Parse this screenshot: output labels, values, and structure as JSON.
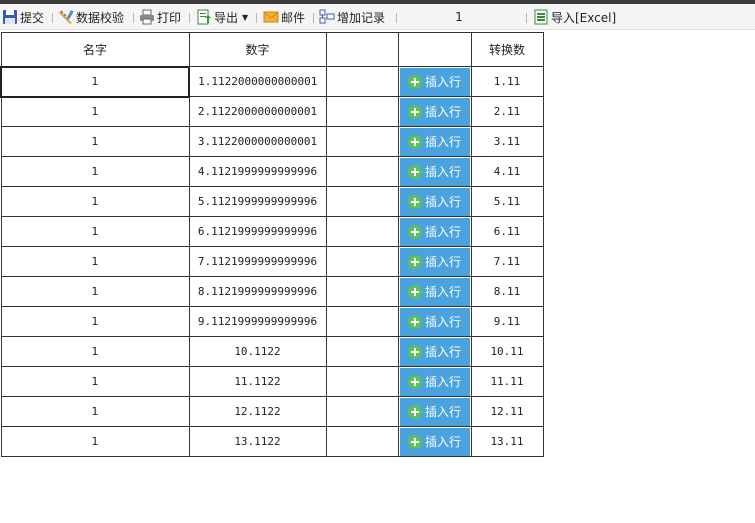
{
  "toolbar": {
    "submit_label": "提交",
    "validate_label": "数据校验",
    "print_label": "打印",
    "export_label": "导出",
    "mail_label": "邮件",
    "add_record_label": "增加记录",
    "page_value": "1",
    "import_label": "导入[Excel]"
  },
  "table": {
    "headers": [
      "名字",
      "数字",
      "",
      "",
      "转换数"
    ],
    "insert_label": "插入行",
    "rows": [
      {
        "name": "1",
        "number": "1.1122000000000001",
        "converted": "1.11"
      },
      {
        "name": "1",
        "number": "2.1122000000000001",
        "converted": "2.11"
      },
      {
        "name": "1",
        "number": "3.1122000000000001",
        "converted": "3.11"
      },
      {
        "name": "1",
        "number": "4.1121999999999996",
        "converted": "4.11"
      },
      {
        "name": "1",
        "number": "5.1121999999999996",
        "converted": "5.11"
      },
      {
        "name": "1",
        "number": "6.1121999999999996",
        "converted": "6.11"
      },
      {
        "name": "1",
        "number": "7.1121999999999996",
        "converted": "7.11"
      },
      {
        "name": "1",
        "number": "8.1121999999999996",
        "converted": "8.11"
      },
      {
        "name": "1",
        "number": "9.1121999999999996",
        "converted": "9.11"
      },
      {
        "name": "1",
        "number": "10.1122",
        "converted": "10.11"
      },
      {
        "name": "1",
        "number": "11.1122",
        "converted": "11.11"
      },
      {
        "name": "1",
        "number": "12.1122",
        "converted": "12.11"
      },
      {
        "name": "1",
        "number": "13.1122",
        "converted": "13.11"
      }
    ]
  },
  "icons": {
    "submit": "save-icon",
    "validate": "ruler-pencil-icon",
    "print": "printer-icon",
    "export": "export-icon",
    "mail": "envelope-icon",
    "add_record": "add-record-icon",
    "import": "excel-icon"
  },
  "colors": {
    "insert_button": "#4aa3df",
    "plus_circle": "#5cc05c"
  }
}
